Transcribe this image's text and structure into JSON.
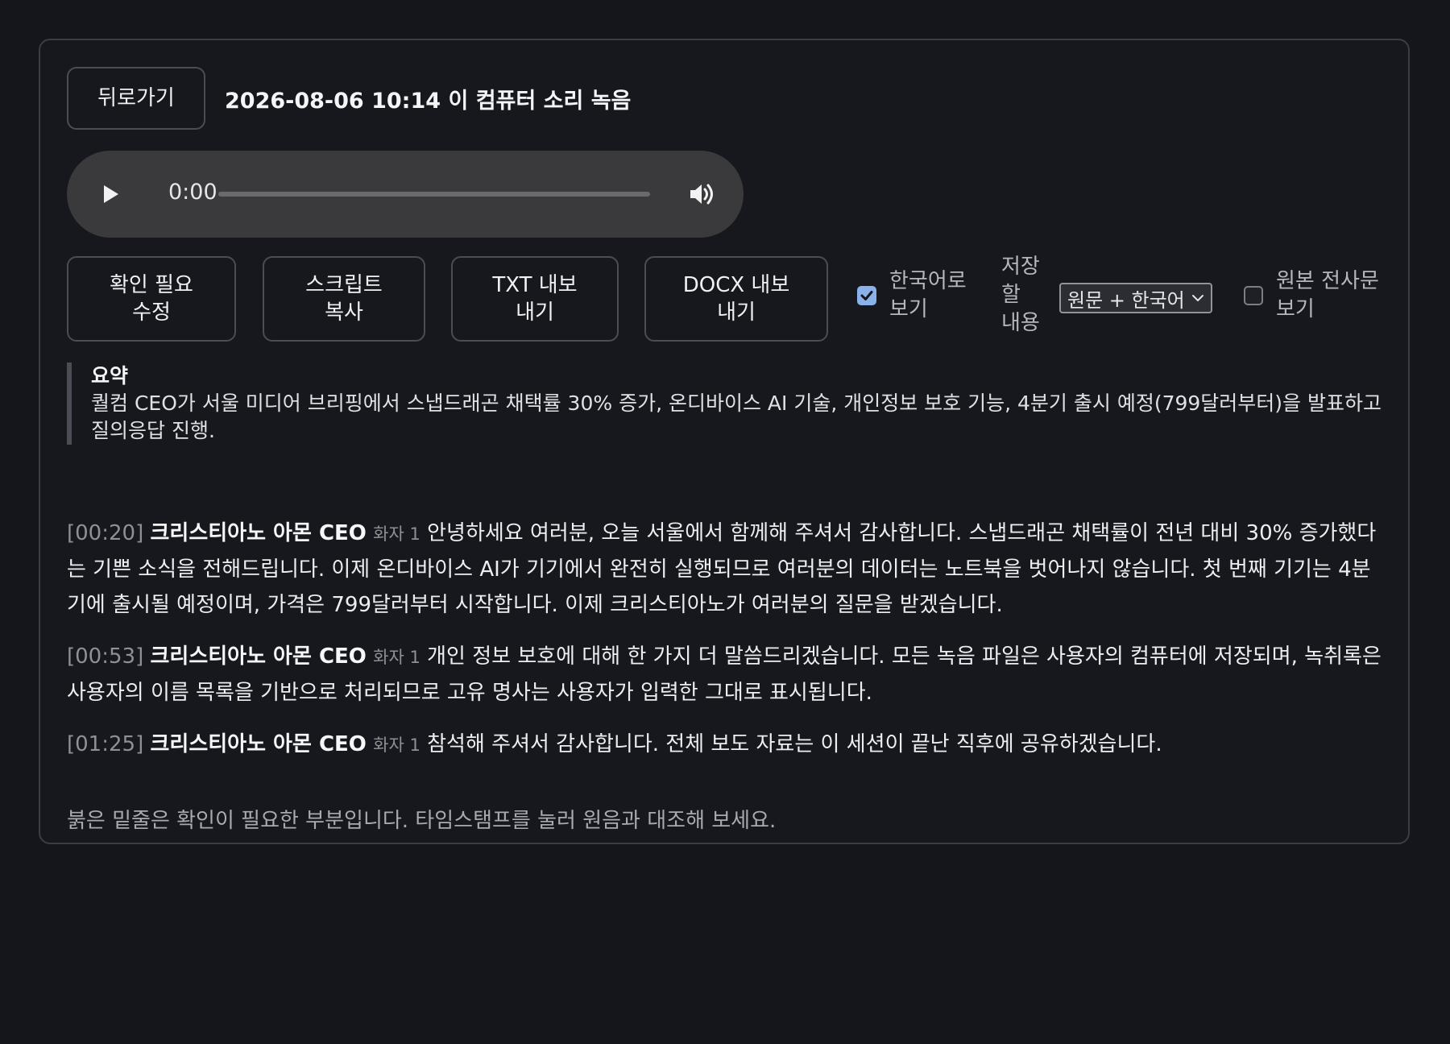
{
  "header": {
    "back_label": "뒤로가기",
    "title": "2026-08-06 10:14 이 컴퓨터 소리 녹음"
  },
  "player": {
    "current_time": "0:00",
    "progress": 0
  },
  "toolbar": {
    "review_button": "확인 필요 수정",
    "copy_button": "스크립트 복사",
    "txt_button": "TXT 내보내기",
    "docx_button": "DOCX 내보내기",
    "korean_view_label": "한국어로 보기",
    "korean_view_checked": true,
    "save_content_label": "저장할 내용",
    "save_content_value": "원문 + 한국어",
    "original_view_label": "원본 전사문 보기",
    "original_view_checked": false
  },
  "summary": {
    "heading": "요약",
    "text": "퀄컴 CEO가 서울 미디어 브리핑에서 스냅드래곤 채택률 30% 증가, 온디바이스 AI 기술, 개인정보 보호 기능, 4분기 출시 예정(799달러부터)을 발표하고 질의응답 진행."
  },
  "transcript": [
    {
      "timestamp": "[00:20]",
      "speaker": "크리스티아노 아몬 CEO",
      "speaker_tag": "화자 1",
      "text": "안녕하세요 여러분, 오늘 서울에서 함께해 주셔서 감사합니다. 스냅드래곤 채택률이 전년 대비 30% 증가했다는 기쁜 소식을 전해드립니다. 이제 온디바이스 AI가 기기에서 완전히 실행되므로 여러분의 데이터는 노트북을 벗어나지 않습니다. 첫 번째 기기는 4분기에 출시될 예정이며, 가격은 799달러부터 시작합니다. 이제 크리스티아노가 여러분의 질문을 받겠습니다."
    },
    {
      "timestamp": "[00:53]",
      "speaker": "크리스티아노 아몬 CEO",
      "speaker_tag": "화자 1",
      "text": "개인 정보 보호에 대해 한 가지 더 말씀드리겠습니다. 모든 녹음 파일은 사용자의 컴퓨터에 저장되며, 녹취록은 사용자의 이름 목록을 기반으로 처리되므로 고유 명사는 사용자가 입력한 그대로 표시됩니다."
    },
    {
      "timestamp": "[01:25]",
      "speaker": "크리스티아노 아몬 CEO",
      "speaker_tag": "화자 1",
      "text": "참석해 주셔서 감사합니다. 전체 보도 자료는 이 세션이 끝난 직후에 공유하겠습니다."
    }
  ],
  "footnote": "붉은 밑줄은 확인이 필요한 부분입니다. 타임스탬프를 눌러 원음과 대조해 보세요.",
  "colors": {
    "background": "#14161b",
    "panel": "#16181d",
    "accent_checkbox": "#8ab1ea",
    "muted_text": "#8d9097"
  }
}
